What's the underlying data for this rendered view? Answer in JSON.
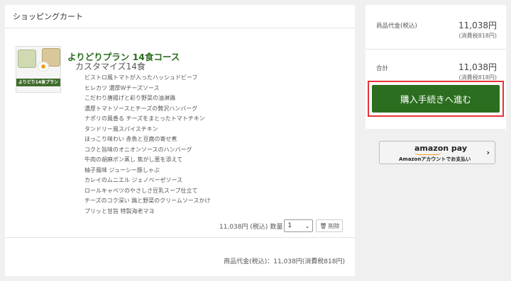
{
  "cart": {
    "title": "ショッピングカート",
    "item": {
      "image_caption": "よりどり14食プラン",
      "plan_name": "よりどりプラン 14食コース",
      "customize_label": "カスタマイズ14食",
      "dishes": [
        "ビストロ風トマトが入ったハッシュドビーフ",
        "ヒレカツ 濃厚Wチーズソース",
        "こだわり唐揚げと彩り野菜の油淋鶏",
        "濃厚トマトソースとチーズの贅沢ハンバーグ",
        "ナポリの風香る チーズをまとったトマトチキン",
        "タンドリー風スパイスチキン",
        "ほっこり味わい 赤魚と豆腐の寄せ煮",
        "コクと旨味のオニオンソースのハンバーグ",
        "牛肉の胡麻ポン蒸し 焦がし葱を添えて",
        "柚子風味 ジューシー豚しゃぶ",
        "カレイのムニエル ジェノベーゼソース",
        "ロールキャベツのやさしさ豆乳スープ仕立て",
        "チーズのコク深い 鶏と野菜のクリームソースかけ",
        "プリッと甘旨 特製海老マヨ"
      ],
      "price": "11,038円 (税込)",
      "qty_label": "数量",
      "qty_value": "1",
      "delete_label": "削除"
    },
    "subtotal": "商品代金(税込)：11,038円(消費税818円)"
  },
  "summary": {
    "product_label": "商品代金(税込)",
    "product_amount": "11,038円",
    "product_tax": "(消費税818円)",
    "total_label": "合計",
    "total_amount": "11,038円",
    "total_tax": "(消費税818円)",
    "checkout_label": "購入手続きへ進む"
  },
  "amazon_pay": {
    "logo": "amazon pay",
    "sub": "Amazonアカウントでお支払い"
  },
  "colors": {
    "accent_green": "#2b6e1f",
    "highlight_red": "#e63333"
  }
}
